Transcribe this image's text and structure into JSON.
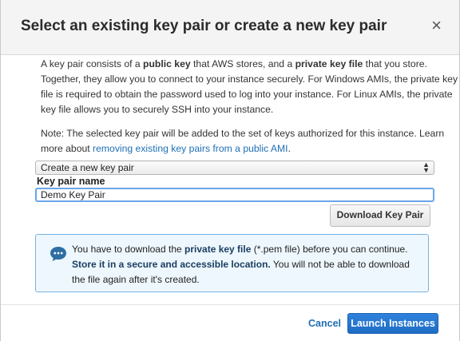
{
  "dialog": {
    "title": "Select an existing key pair or create a new key pair",
    "close_glyph": "×"
  },
  "description": {
    "t1": "A key pair consists of a ",
    "b1": "public key",
    "t2": " that AWS stores, and a ",
    "b2": "private key file",
    "t3": " that you store. Together, they allow you to connect to your instance securely. For Windows AMIs, the private key file is required to obtain the password used to log into your instance. For Linux AMIs, the private key file allows you to securely SSH into your instance."
  },
  "note": {
    "text": "Note: The selected key pair will be added to the set of keys authorized for this instance. Learn more about ",
    "link": "removing existing key pairs from a public AMI",
    "end": "."
  },
  "key_pair_select": {
    "selected": "Create a new key pair"
  },
  "key_pair_name": {
    "label": "Key pair name",
    "value": "Demo Key Pair"
  },
  "download_button": "Download Key Pair",
  "info": {
    "t1": "You have to download the ",
    "b1": "private key file",
    "t2": " (*.pem file) before you can continue. ",
    "b2": "Store it in a secure and accessible location.",
    "t3": " You will not be able to download the file again after it's created."
  },
  "footer": {
    "cancel": "Cancel",
    "launch": "Launch Instances"
  },
  "colors": {
    "link": "#1f6fb5",
    "primary_button": "#2277d0",
    "info_border": "#77b3e0",
    "info_bg": "#eef7fd",
    "header_bg": "#f4f4f4"
  },
  "icons": {
    "close": "close-icon",
    "select_arrows": "updown-arrows-icon",
    "info": "chat-bubble-icon"
  }
}
